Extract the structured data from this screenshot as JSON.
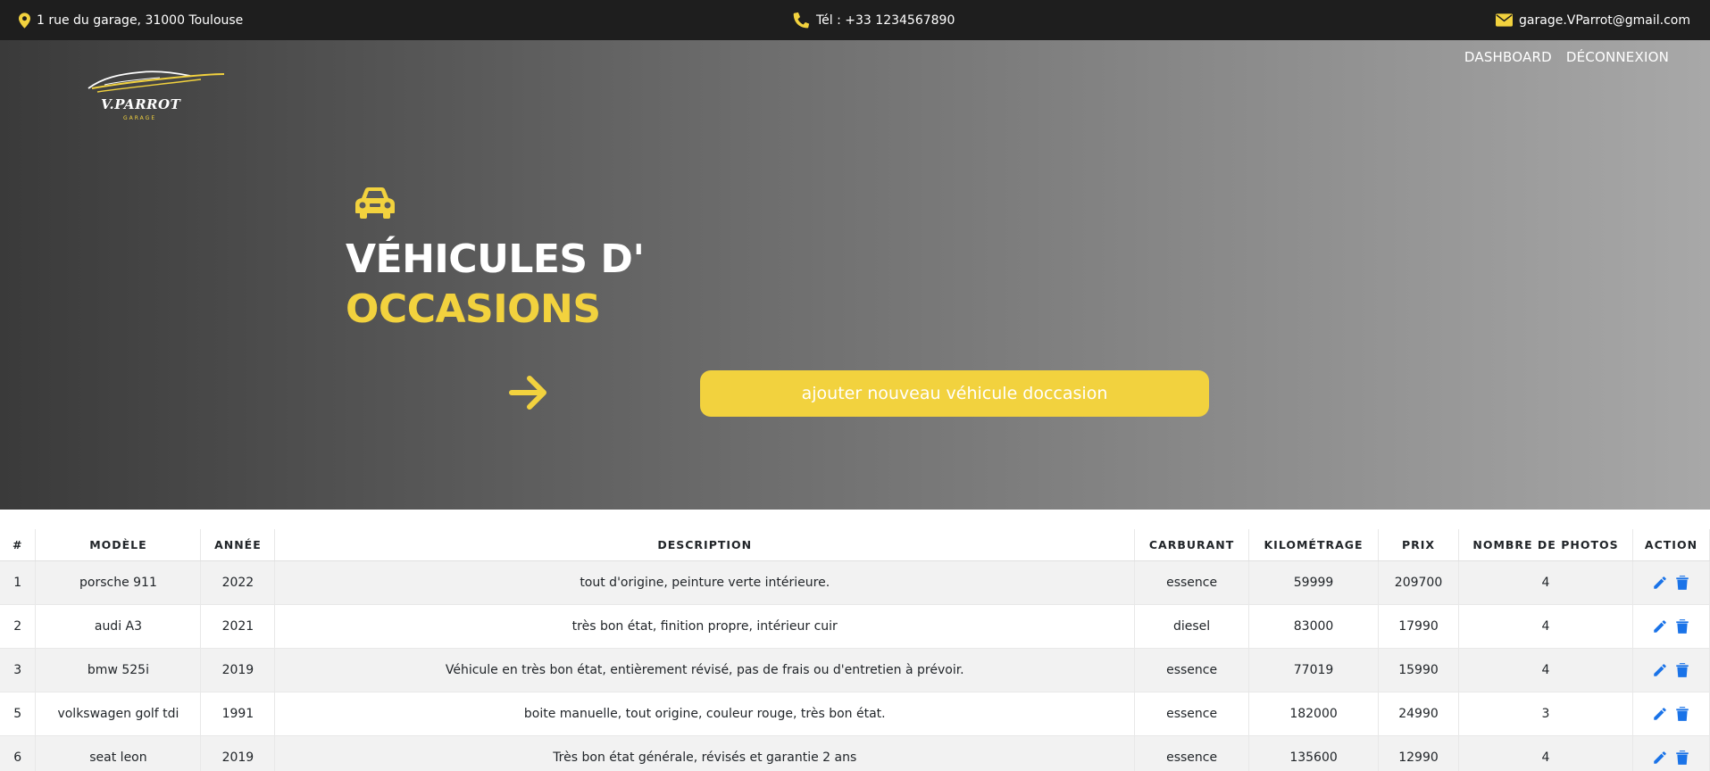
{
  "topbar": {
    "address": "1 rue du garage, 31000 Toulouse",
    "phone": "Tél : +33 1234567890",
    "email": "garage.VParrot@gmail.com",
    "icon_color": "#f2d23e"
  },
  "logo": {
    "brand": "V.PARROT",
    "sub": "GARAGE"
  },
  "nav": {
    "dashboard": "DASHBOARD",
    "logout": "DÉCONNEXION"
  },
  "hero": {
    "title_line1": "VÉHICULES D'",
    "title_line2": "OCCASIONS",
    "add_button": "ajouter nouveau véhicule doccasion",
    "accent": "#f2d23e"
  },
  "table": {
    "headers": [
      "#",
      "MODÈLE",
      "ANNÉE",
      "DESCRIPTION",
      "CARBURANT",
      "KILOMÉTRAGE",
      "PRIX",
      "NOMBRE DE PHOTOS",
      "ACTION"
    ],
    "rows": [
      {
        "id": "1",
        "model": "porsche 911",
        "year": "2022",
        "description": "tout d'origine, peinture verte intérieure.",
        "fuel": "essence",
        "km": "59999",
        "price": "209700",
        "photos": "4"
      },
      {
        "id": "2",
        "model": "audi A3",
        "year": "2021",
        "description": "très bon état, finition propre, intérieur cuir",
        "fuel": "diesel",
        "km": "83000",
        "price": "17990",
        "photos": "4"
      },
      {
        "id": "3",
        "model": "bmw 525i",
        "year": "2019",
        "description": "Véhicule en très bon état, entièrement révisé, pas de frais ou d'entretien à prévoir.",
        "fuel": "essence",
        "km": "77019",
        "price": "15990",
        "photos": "4"
      },
      {
        "id": "5",
        "model": "volkswagen golf tdi",
        "year": "1991",
        "description": "boite manuelle, tout origine, couleur rouge, très bon état.",
        "fuel": "essence",
        "km": "182000",
        "price": "24990",
        "photos": "3"
      },
      {
        "id": "6",
        "model": "seat leon",
        "year": "2019",
        "description": "Très bon état générale, révisés et garantie 2 ans",
        "fuel": "essence",
        "km": "135600",
        "price": "12990",
        "photos": "4"
      }
    ],
    "action_icons": [
      "pencil-icon",
      "trash-icon"
    ],
    "action_color": "#1a73e8"
  }
}
